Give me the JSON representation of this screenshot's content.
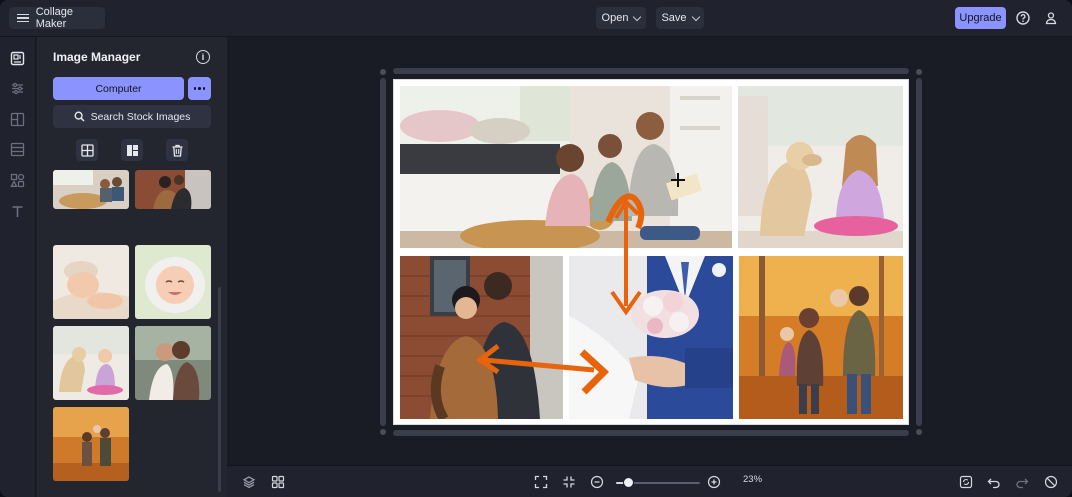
{
  "app": {
    "title": "Collage Maker"
  },
  "header": {
    "open_label": "Open",
    "save_label": "Save",
    "upgrade_label": "Upgrade",
    "icons": [
      "menu-icon",
      "help-icon",
      "user-icon"
    ]
  },
  "rail": {
    "icons": [
      "image-manager-icon",
      "adjustments-icon",
      "layout-icon",
      "background-icon",
      "elements-icon",
      "text-icon"
    ]
  },
  "image_manager": {
    "title": "Image Manager",
    "computer_label": "Computer",
    "more_label": "•••",
    "search_label": "Search Stock Images",
    "tools": [
      "add-to-grid-icon",
      "auto-fill-icon",
      "trash-icon"
    ]
  },
  "bottom": {
    "zoom_label": "23%",
    "zoom_percent": 23,
    "icons": [
      "layers-icon",
      "grid-icon",
      "fit-screen-icon",
      "actual-size-icon",
      "zoom-out-icon",
      "zoom-in-icon",
      "refresh-icon",
      "undo-icon",
      "redo-icon",
      "reset-icon"
    ]
  },
  "colors": {
    "accent": "#8b93ff",
    "background": "#1c1e27",
    "panel": "#23252f",
    "arrows": "#e8640c"
  }
}
